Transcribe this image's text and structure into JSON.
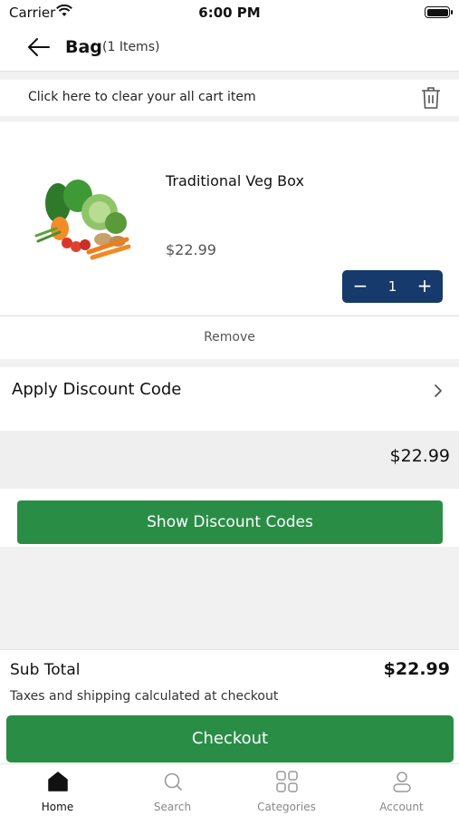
{
  "status_bar": {
    "carrier": "Carrier",
    "time": "6:00 PM"
  },
  "header": {
    "title": "Bag",
    "count": "(1 Items)"
  },
  "clear_cart": {
    "text": "Click here to clear your all cart item"
  },
  "cart_item": {
    "name": "Traditional Veg Box",
    "price": "$22.99",
    "quantity": "1",
    "minus": "−",
    "plus": "+",
    "remove_label": "Remove"
  },
  "discount": {
    "label": "Apply Discount Code"
  },
  "band_total": "$22.99",
  "show_codes_label": "Show Discount Codes",
  "summary": {
    "subtotal_label": "Sub Total",
    "subtotal_value": "$22.99",
    "note": "Taxes and shipping calculated at checkout",
    "checkout_label": "Checkout"
  },
  "tabs": [
    {
      "label": "Home",
      "icon": "home-icon",
      "active": true
    },
    {
      "label": "Search",
      "icon": "search-icon",
      "active": false
    },
    {
      "label": "Categories",
      "icon": "categories-icon",
      "active": false
    },
    {
      "label": "Account",
      "icon": "account-icon",
      "active": false
    }
  ],
  "colors": {
    "primary_green": "#2a8d46",
    "stepper_navy": "#153a6b"
  }
}
